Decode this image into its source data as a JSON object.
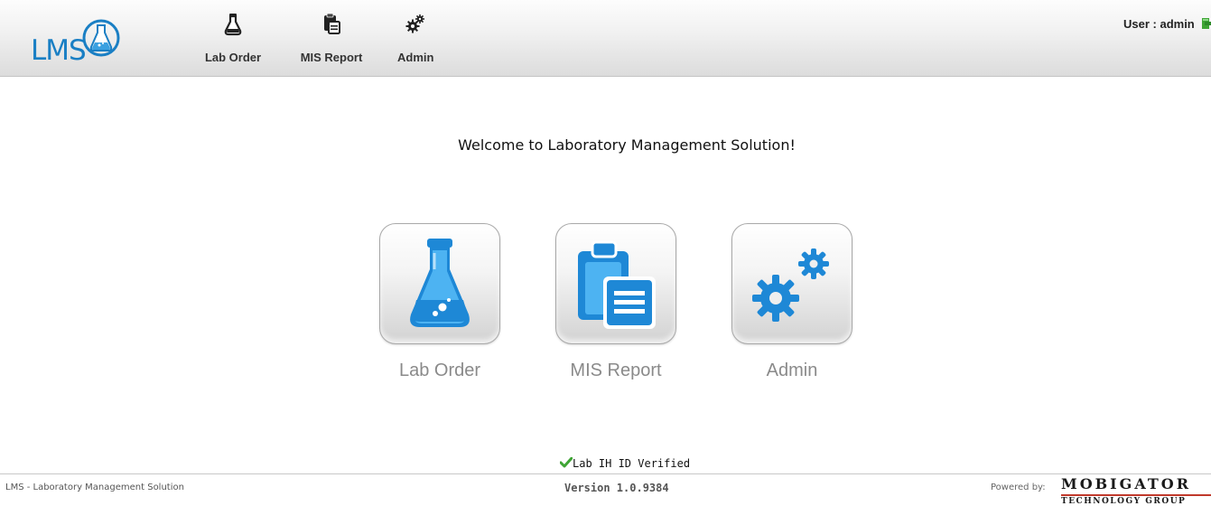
{
  "app": {
    "logo_text": "LMS"
  },
  "header": {
    "nav": [
      {
        "label": "Lab Order",
        "icon": "flask-icon"
      },
      {
        "label": "MIS Report",
        "icon": "clipboard-report-icon"
      },
      {
        "label": "Admin",
        "icon": "gears-icon"
      }
    ],
    "user_text": "User : admin",
    "logout_icon": "logout-icon"
  },
  "main": {
    "welcome": "Welcome to Laboratory Management Solution!",
    "tiles": [
      {
        "label": "Lab Order",
        "icon": "flask-icon"
      },
      {
        "label": "MIS Report",
        "icon": "clipboard-report-icon"
      },
      {
        "label": "Admin",
        "icon": "gears-icon"
      }
    ]
  },
  "status": {
    "verified_text": "Lab IH ID Verified",
    "verified_icon": "check-icon"
  },
  "footer": {
    "left_text": "LMS - Laboratory Management Solution",
    "version": "Version 1.0.9384",
    "powered_by": "Powered by:",
    "brand_name": "MOBIGATOR",
    "brand_sub": "TECHNOLOGY GROUP"
  },
  "colors": {
    "accent_blue": "#1a7fc4",
    "icon_blue": "#1e88d6",
    "header_bg": "#e6e6e6",
    "tile_label": "#8a8a8a",
    "check_green": "#3fa535",
    "brand_red": "#c0392b"
  }
}
